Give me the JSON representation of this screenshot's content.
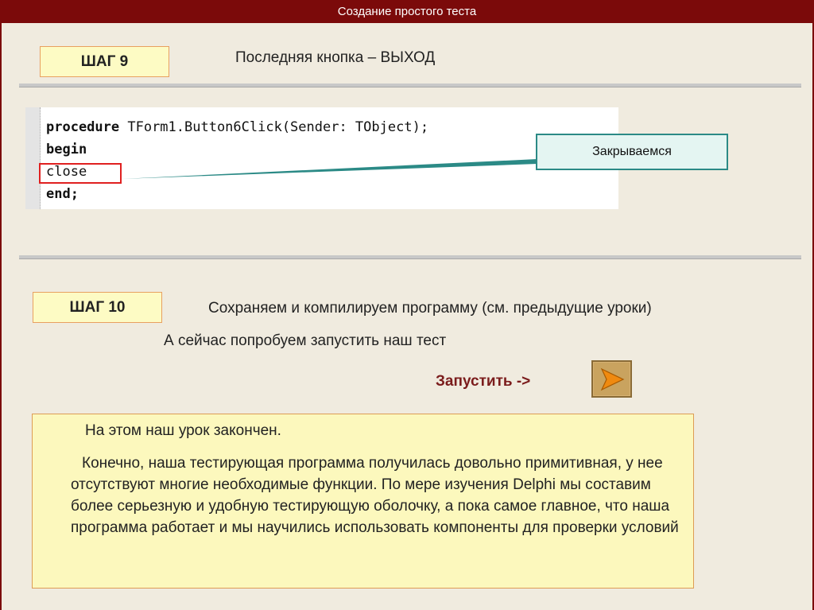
{
  "header": {
    "title": "Создание простого теста"
  },
  "step9": {
    "label": "ШАГ 9",
    "description": "Последняя кнопка – ВЫХОД",
    "code": {
      "line1_kw": "procedure",
      "line1_rest": " TForm1.Button6Click(Sender: TObject);",
      "line2": "begin",
      "line3": "close",
      "line4": "end;"
    },
    "callout": "Закрываемся"
  },
  "step10": {
    "label": "ШАГ 10",
    "description": "Сохраняем и компилируем программу (см. предыдущие уроки)",
    "subtext": "А сейчас попробуем запустить наш тест",
    "run_label": "Запустить ->",
    "run_icon": "play-arrow-icon"
  },
  "conclusion": {
    "title": "На этом наш урок закончен.",
    "body": "Конечно, наша тестирующая программа получилась довольно примитивная, у нее отсутствуют многие необходимые функции. По мере изучения Delphi мы составим более серьезную и удобную тестирующую оболочку, а пока самое главное, что наша программа работает и мы научились использовать компоненты для проверки условий"
  },
  "colors": {
    "title_bar": "#7b0a0a",
    "background": "#f0ebdf",
    "step_box_fill": "#fdfbc4",
    "step_box_border": "#e8a060",
    "callout_border": "#2b8a86",
    "highlight_red": "#e02020",
    "run_label": "#7b1c1c"
  }
}
